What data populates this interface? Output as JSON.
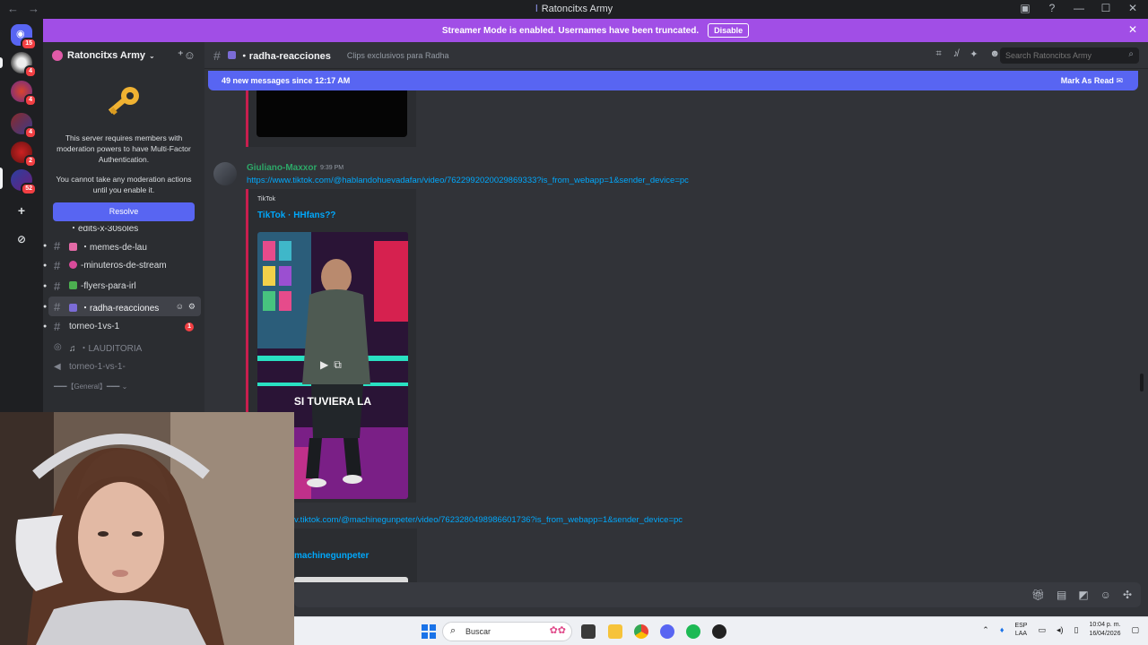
{
  "window": {
    "title": "Ratoncitxs Army",
    "nav": [
      "←",
      "→"
    ],
    "controls": [
      "—",
      "☐",
      "✕"
    ]
  },
  "banner": {
    "text": "Streamer Mode is enabled. Usernames have been truncated.",
    "disable_label": "Disable",
    "close": "✕",
    "color": "#a14ee6"
  },
  "rail": {
    "badges": [
      "15",
      "4",
      "4",
      "4",
      "2",
      "52"
    ]
  },
  "sidebar": {
    "server_name": "Ratoncitxs Army",
    "mfa_text": "This server requires members with moderation powers to have Multi-Factor Authentication.",
    "mfa_text2": "You cannot take any moderation actions until you enable it.",
    "resolve_label": "Resolve",
    "channels": [
      {
        "name": "・edits-x-30soles"
      },
      {
        "name": "・memes-de-lau"
      },
      {
        "name": "-minuteros-de-stream"
      },
      {
        "name": "-flyers-para-irl"
      },
      {
        "name": "・radha-reacciones"
      },
      {
        "name": "torneo-1vs-1",
        "mentions": "1"
      },
      {
        "name": "・LAUDITORIA"
      },
      {
        "name": "torneo-1-vs-1-"
      }
    ],
    "category": "━━━【General】━━━"
  },
  "channel": {
    "name": "・radha-reacciones",
    "topic": "Clips exclusivos para Radha",
    "search_placeholder": "Search Ratoncitxs Army"
  },
  "newbar": {
    "text": "49 new messages since 12:17 AM",
    "mark_read": "Mark As Read",
    "color": "#5865f2"
  },
  "message": {
    "author": "Giuliano-Maxxor",
    "time": "9:39 PM",
    "link": "https://www.tiktok.com/@hablandohuevadafan/video/7622992020029869333?is_from_webapp=1&sender_device=pc",
    "embed_provider": "TikTok",
    "embed_title": "TikTok · HHfans??",
    "video_caption": "SI TUVIERA LA",
    "link2": "v.tiktok.com/@machinegunpeter/video/7623280498986601736?is_from_webapp=1&sender_device=pc",
    "embed2_title": "machinegunpeter"
  },
  "taskbar": {
    "search_label": "Buscar",
    "lang": [
      "ESP",
      "LAA"
    ],
    "time": "10:04 p. m.",
    "date": "16/04/2026"
  },
  "icons": [
    "back-icon",
    "forward-icon",
    "inbox-icon",
    "help-icon",
    "threads-icon",
    "mute-icon",
    "pin-icon",
    "members-icon",
    "search-icon",
    "gift-icon",
    "gif-icon",
    "sticker-icon",
    "emoji-icon",
    "apps-icon"
  ]
}
